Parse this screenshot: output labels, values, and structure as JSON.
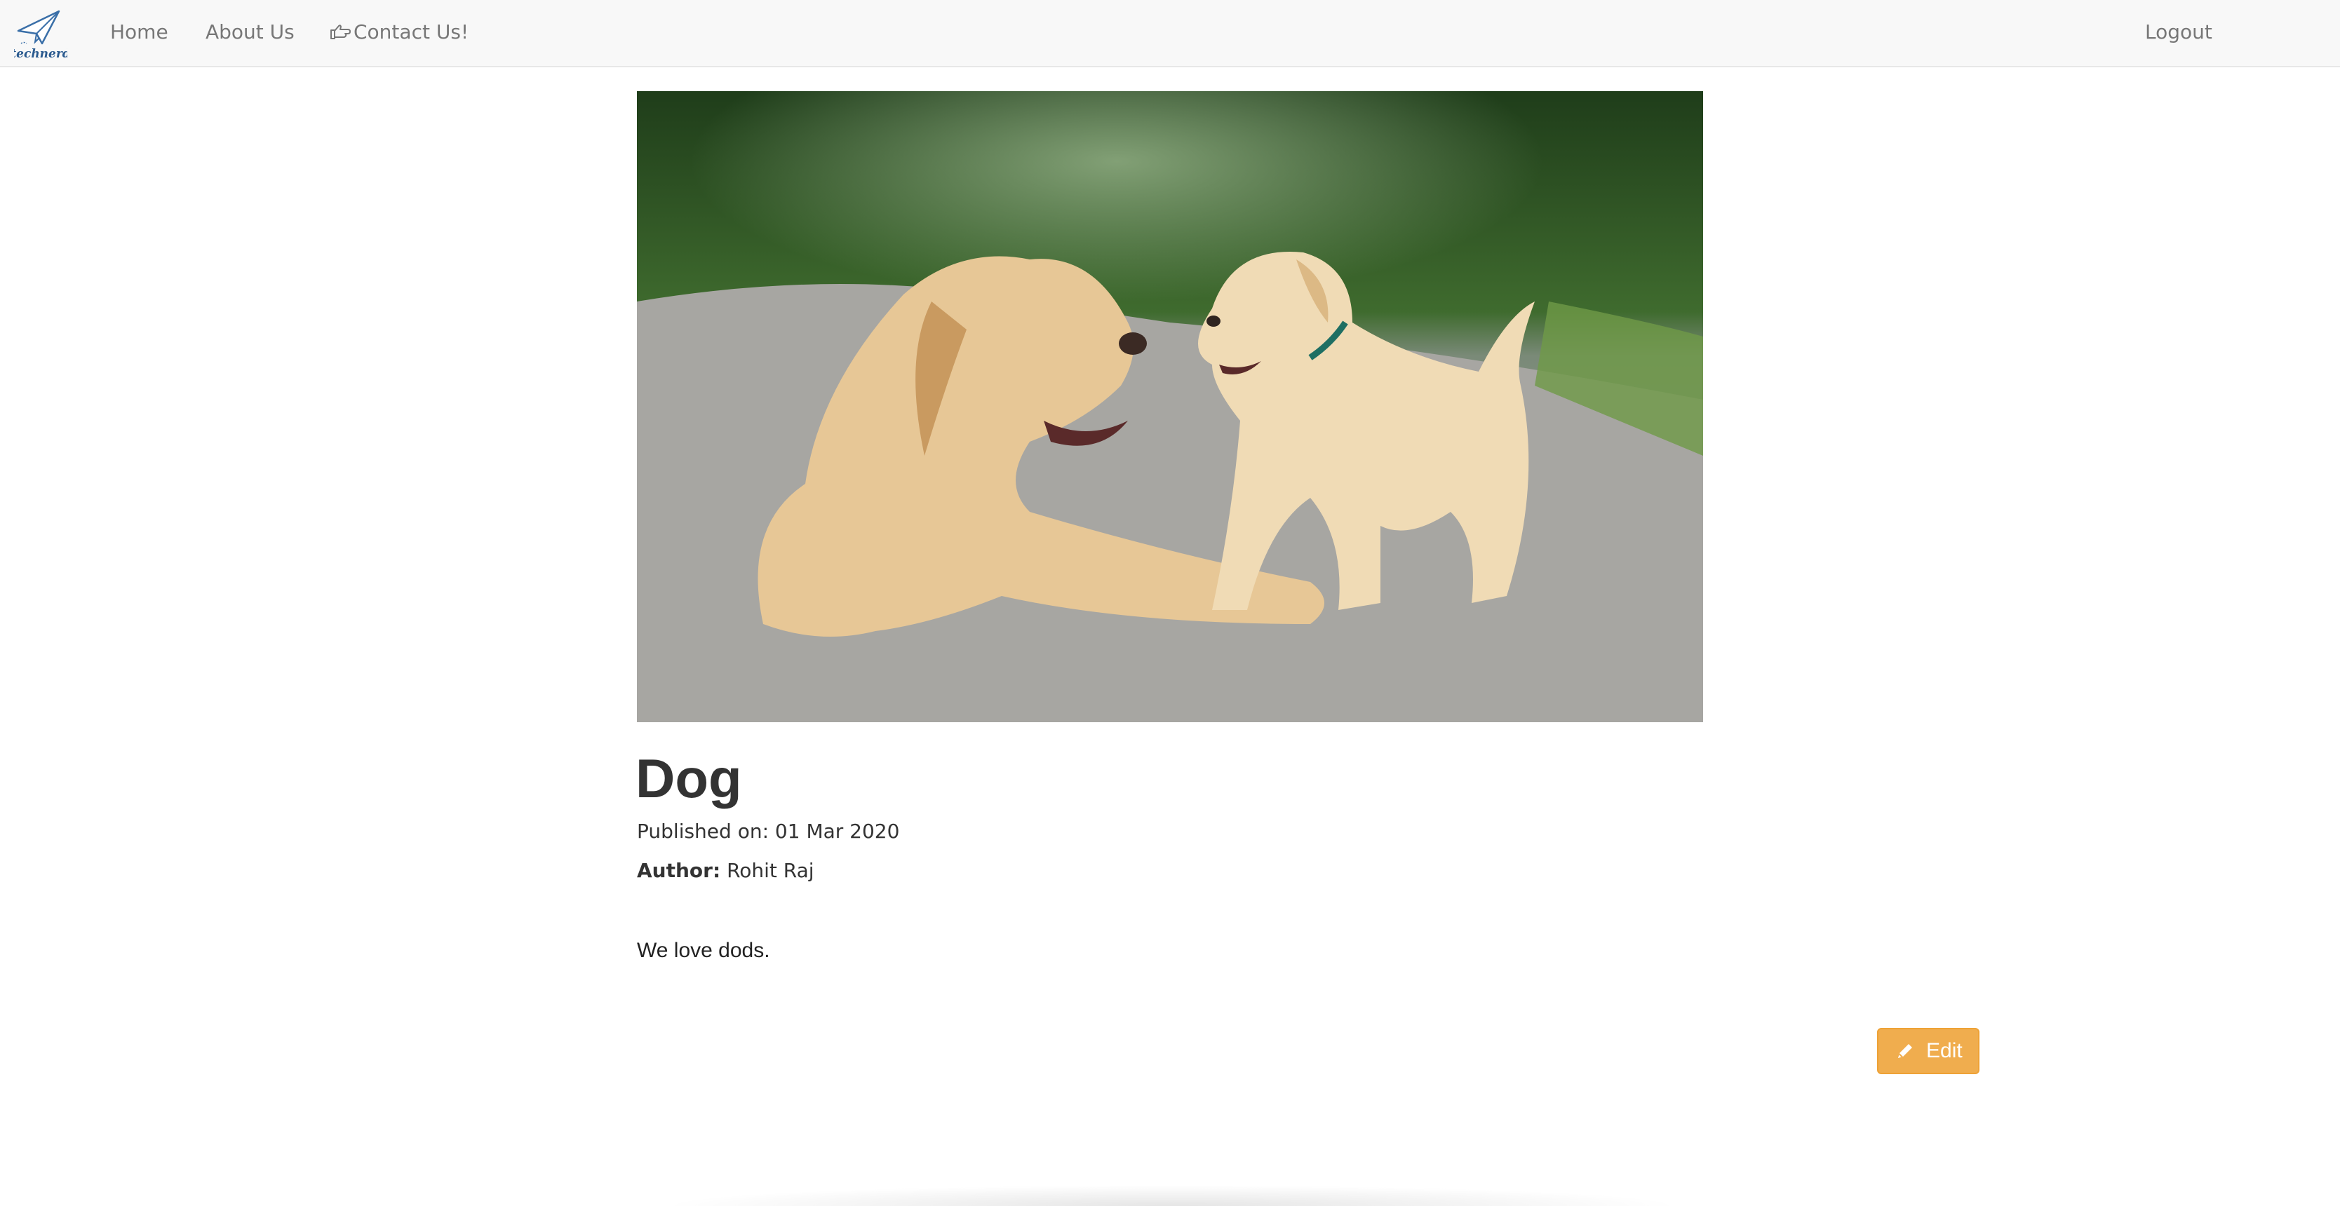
{
  "navbar": {
    "logo_text": "technerd",
    "links": [
      {
        "label": "Home"
      },
      {
        "label": "About Us"
      },
      {
        "label": "Contact Us!",
        "icon": "hand-point-right-icon"
      }
    ],
    "logout_label": "Logout"
  },
  "post": {
    "image_description_icon": "dogs-photo",
    "title": "Dog",
    "published": "Published on: 01 Mar 2020",
    "author_label": "Author:",
    "author_name": "Rohit Raj",
    "body": "We love dods.",
    "edit_label": "Edit",
    "edit_icon": "pencil-icon"
  },
  "colors": {
    "navbar_bg": "#f8f8f8",
    "nav_text": "#777777",
    "edit_button": "#f0ad4e",
    "text": "#333333"
  }
}
